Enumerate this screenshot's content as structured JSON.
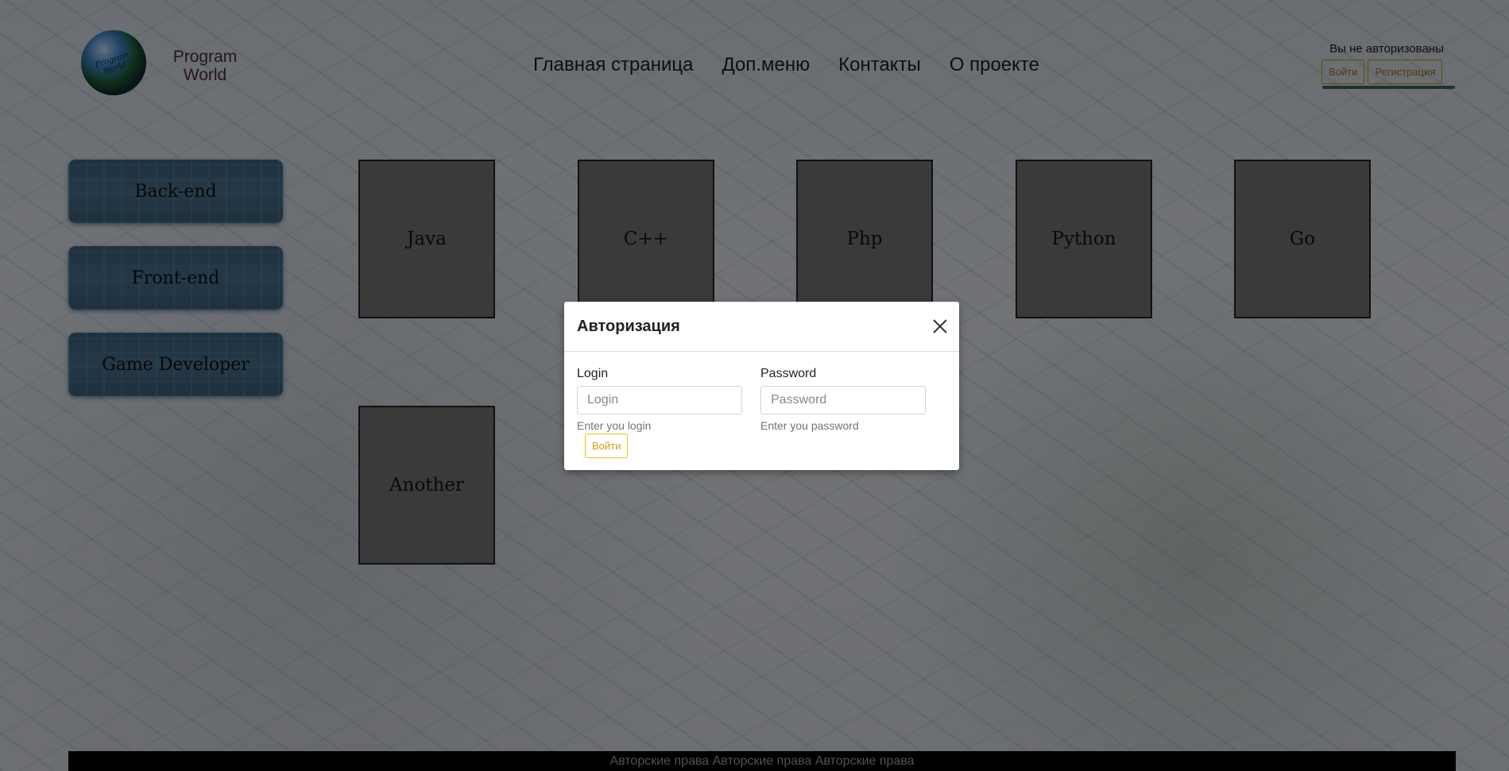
{
  "brand": {
    "logo_text": "Program World",
    "name_line1": "Program",
    "name_line2": "World"
  },
  "nav": [
    "Главная страница",
    "Доп.меню",
    "Контакты",
    "О проекте"
  ],
  "auth": {
    "status": "Вы не авторизованы",
    "login_label": "Войти",
    "register_label": "Регистрация"
  },
  "sidebar": [
    "Back-end",
    "Front-end",
    "Game Developer"
  ],
  "tiles": [
    "Java",
    "C++",
    "Php",
    "Python",
    "Go",
    "Another"
  ],
  "modal": {
    "title": "Авторизация",
    "login": {
      "label": "Login",
      "placeholder": "Login",
      "hint": "Enter you login"
    },
    "password": {
      "label": "Password",
      "placeholder": "Password",
      "hint": "Enter you password"
    },
    "submit_label": "Войти"
  },
  "footer": {
    "text": "Авторские права Авторские права Авторские права"
  }
}
